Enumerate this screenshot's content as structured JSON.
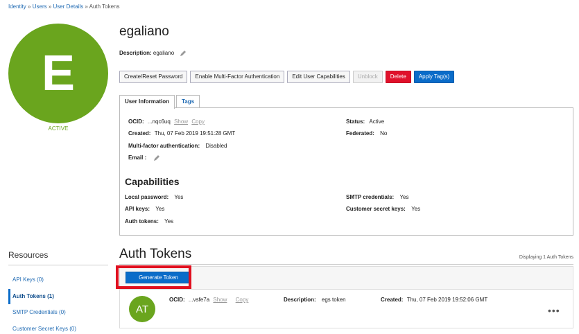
{
  "breadcrumb": {
    "items": [
      "Identity",
      "Users",
      "User Details"
    ],
    "separator": "»",
    "current": "Auth Tokens"
  },
  "user": {
    "avatar_letter": "E",
    "status": "ACTIVE",
    "name": "egaliano",
    "description_label": "Description:",
    "description_value": "egaliano"
  },
  "actions": {
    "create_reset_password": "Create/Reset Password",
    "enable_mfa": "Enable Multi-Factor Authentication",
    "edit_capabilities": "Edit User Capabilities",
    "unblock": "Unblock",
    "delete": "Delete",
    "apply_tags": "Apply Tag(s)"
  },
  "tabs": {
    "user_information": "User Information",
    "tags": "Tags"
  },
  "user_info": {
    "ocid_label": "OCID:",
    "ocid_value": "...nqc6uq",
    "show": "Show",
    "copy": "Copy",
    "created_label": "Created:",
    "created_value": "Thu, 07 Feb 2019 19:51:28 GMT",
    "mfa_label": "Multi-factor authentication:",
    "mfa_value": "Disabled",
    "email_label": "Email :",
    "status_label": "Status:",
    "status_value": "Active",
    "federated_label": "Federated:",
    "federated_value": "No"
  },
  "capabilities": {
    "title": "Capabilities",
    "local_password_label": "Local password:",
    "local_password_value": "Yes",
    "api_keys_label": "API keys:",
    "api_keys_value": "Yes",
    "auth_tokens_label": "Auth tokens:",
    "auth_tokens_value": "Yes",
    "smtp_label": "SMTP credentials:",
    "smtp_value": "Yes",
    "customer_secret_label": "Customer secret keys:",
    "customer_secret_value": "Yes"
  },
  "resources": {
    "title": "Resources",
    "items": [
      "API Keys (0)",
      "Auth Tokens (1)",
      "SMTP Credentials (0)",
      "Customer Secret Keys (0)"
    ]
  },
  "auth_tokens": {
    "title": "Auth Tokens",
    "displaying": "Displaying 1 Auth Tokens",
    "generate_button": "Generate Token",
    "token": {
      "avatar": "AT",
      "ocid_label": "OCID:",
      "ocid_value": "...vsfe7a",
      "show": "Show",
      "copy": "Copy",
      "description_label": "Description:",
      "description_value": "egs token",
      "created_label": "Created:",
      "created_value": "Thu, 07 Feb 2019 19:52:06 GMT",
      "more": "•••"
    }
  },
  "colors": {
    "avatar_green": "#6aa51e",
    "primary_blue": "#0a6cc9",
    "danger_red": "#e0112b",
    "highlight_red": "#e0101f"
  }
}
